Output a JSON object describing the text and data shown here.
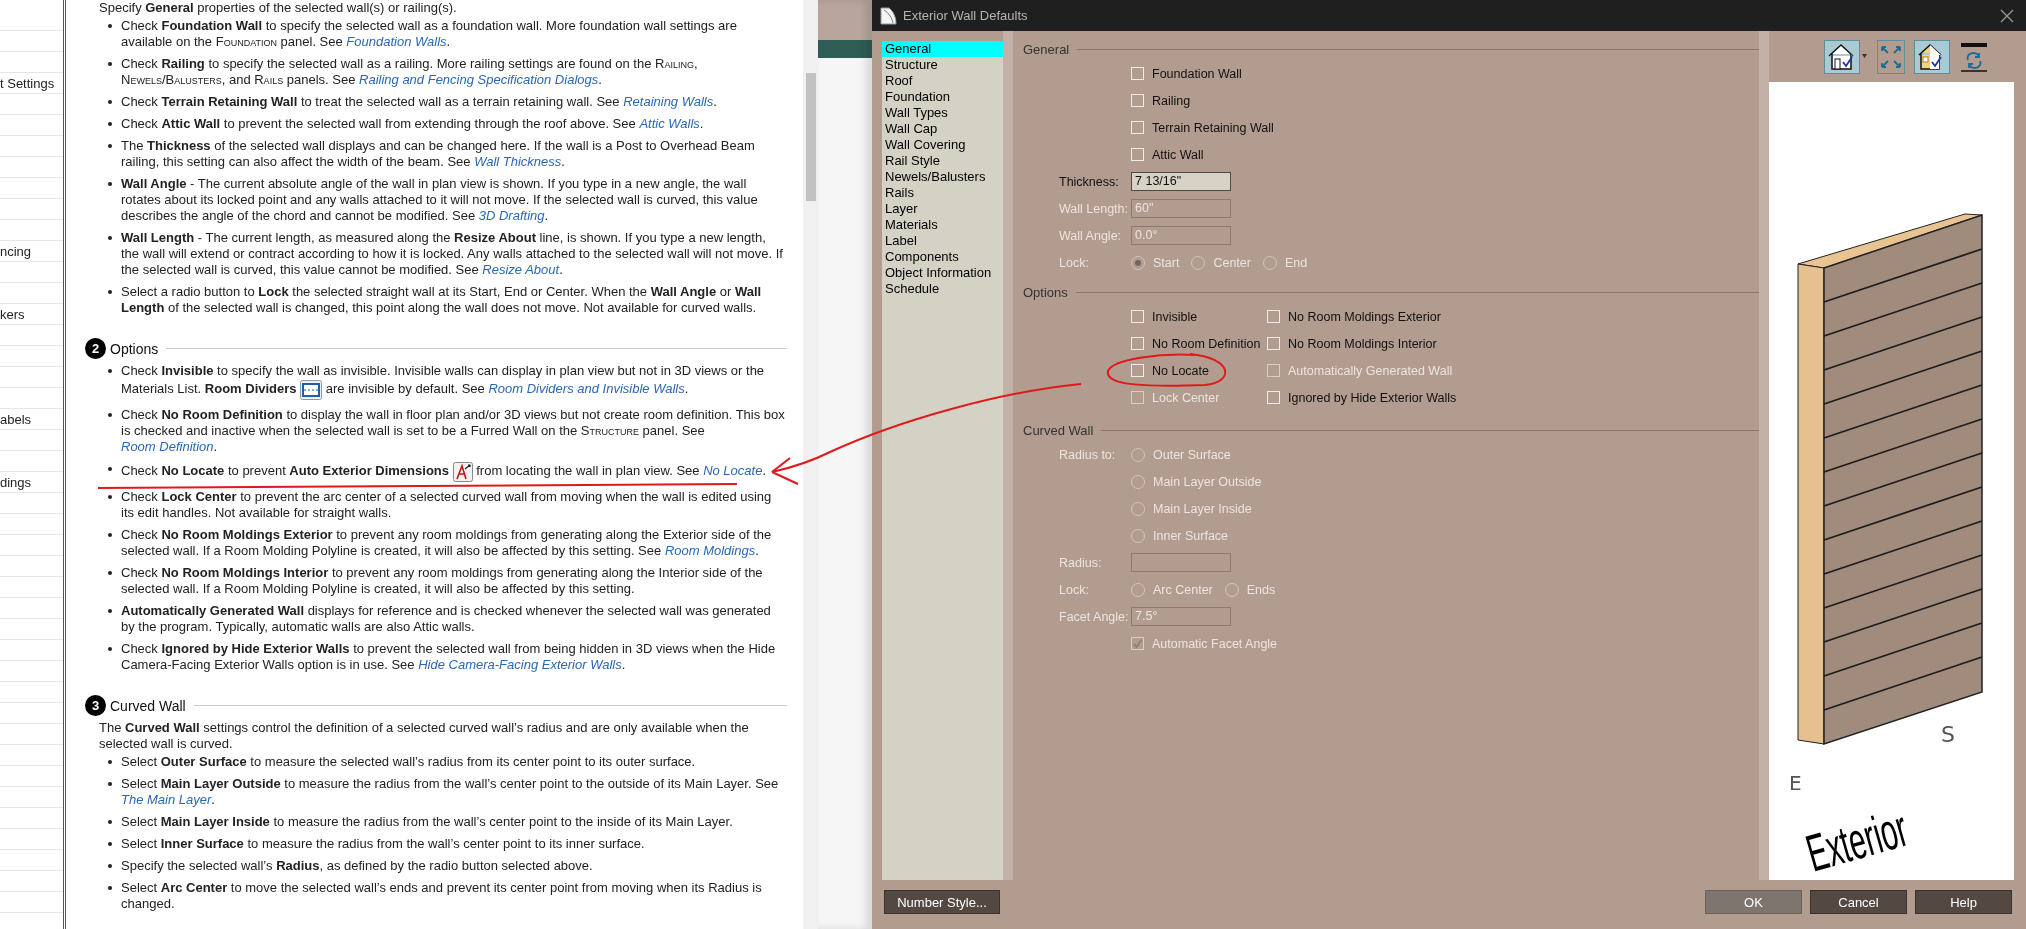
{
  "sidebar": {
    "items": [
      {
        "label": "t Settings"
      },
      {
        "label": "ncing"
      },
      {
        "label": "kers"
      },
      {
        "label": "abels"
      },
      {
        "label": "dings"
      }
    ]
  },
  "help": {
    "sections": [
      {
        "intro": "Specify **General** properties of the selected wall(s) or railing(s).",
        "bullets": [
          {
            "parts": [
              {
                "kind": "text",
                "text": "Check **Foundation Wall** to specify the selected wall as a foundation wall. More foundation wall settings are available on the "
              },
              {
                "kind": "smallcaps",
                "text": "Foundation"
              },
              {
                "kind": "text",
                "text": " panel. See "
              },
              {
                "kind": "link",
                "text": "Foundation Walls"
              },
              {
                "kind": "text",
                "text": "."
              }
            ]
          },
          {
            "parts": [
              {
                "kind": "text",
                "text": "Check **Railing** to specify the selected wall as a railing. More railing settings are found on the "
              },
              {
                "kind": "smallcaps",
                "text": "Railing"
              },
              {
                "kind": "text",
                "text": ", "
              },
              {
                "kind": "smallcaps",
                "text": "Newels/Balusters"
              },
              {
                "kind": "text",
                "text": ", and "
              },
              {
                "kind": "smallcaps",
                "text": "Rails"
              },
              {
                "kind": "text",
                "text": " panels. See "
              },
              {
                "kind": "link",
                "text": "Railing and Fencing Specification Dialogs"
              },
              {
                "kind": "text",
                "text": "."
              }
            ]
          },
          {
            "parts": [
              {
                "kind": "text",
                "text": "Check **Terrain Retaining Wall** to treat the selected wall as a terrain retaining wall. See "
              },
              {
                "kind": "link",
                "text": "Retaining Walls"
              },
              {
                "kind": "text",
                "text": "."
              }
            ]
          },
          {
            "parts": [
              {
                "kind": "text",
                "text": "Check **Attic Wall** to prevent the selected wall from extending through the roof above. See "
              },
              {
                "kind": "link",
                "text": "Attic Walls"
              },
              {
                "kind": "text",
                "text": "."
              }
            ]
          },
          {
            "parts": [
              {
                "kind": "text",
                "text": "The **Thickness** of the selected wall displays and can be changed here. If the wall is a Post to Overhead Beam railing, this setting can also affect the width of the beam. See "
              },
              {
                "kind": "link",
                "text": "Wall Thickness"
              },
              {
                "kind": "text",
                "text": "."
              }
            ]
          },
          {
            "parts": [
              {
                "kind": "text",
                "text": "**Wall Angle** - The current absolute angle of the wall in plan view is shown. If you type in a new angle, the wall rotates about its locked point and any walls attached to it will not move. If the selected wall is curved, this value describes the angle of the chord and cannot be modified. See "
              },
              {
                "kind": "link",
                "text": "3D Drafting"
              },
              {
                "kind": "text",
                "text": "."
              }
            ]
          },
          {
            "parts": [
              {
                "kind": "text",
                "text": "**Wall Length** - The current length, as measured along the **Resize About** line, is shown. If you type a new length, the wall will extend or contract according to how it is locked. Any walls attached to the selected wall will not move. If the selected wall is curved, this value cannot be modified. See "
              },
              {
                "kind": "link",
                "text": "Resize About"
              },
              {
                "kind": "text",
                "text": "."
              }
            ]
          },
          {
            "parts": [
              {
                "kind": "text",
                "text": "Select a radio button to **Lock** the selected straight wall at its Start, End or Center. When the **Wall Angle** or **Wall Length** of the selected wall is changed, this point along the wall does not move. Not available for curved walls."
              }
            ]
          }
        ]
      },
      {
        "number": "2",
        "heading": "Options",
        "bullets": [
          {
            "parts": [
              {
                "kind": "text",
                "text": "Check **Invisible** to specify the wall as invisible. Invisible walls can display in plan view but not in 3D views or the Materials List. **Room Dividers** "
              },
              {
                "kind": "divider-icon"
              },
              {
                "kind": "text",
                "text": " are invisible by default. See "
              },
              {
                "kind": "link",
                "text": "Room Dividers and Invisible Walls"
              },
              {
                "kind": "text",
                "text": "."
              }
            ]
          },
          {
            "parts": [
              {
                "kind": "text",
                "text": "Check **No Room Definition** to display the wall in floor plan and/or 3D views but not create room definition. This box is checked and inactive when the selected wall is set to be a Furred Wall on the "
              },
              {
                "kind": "smallcaps",
                "text": "Structure"
              },
              {
                "kind": "text",
                "text": " panel. See "
              },
              {
                "kind": "link",
                "text": "Room Definition"
              },
              {
                "kind": "text",
                "text": "."
              }
            ]
          },
          {
            "parts": [
              {
                "kind": "text",
                "text": "Check **No Locate** to prevent **Auto Exterior Dimensions** "
              },
              {
                "kind": "dimension-icon"
              },
              {
                "kind": "text",
                "text": " from locating the wall in plan view. See "
              },
              {
                "kind": "link",
                "text": "No Locate"
              },
              {
                "kind": "text",
                "text": "."
              }
            ]
          },
          {
            "parts": [
              {
                "kind": "text",
                "text": "Check **Lock Center** to prevent the arc center of a selected curved wall from moving when the wall is edited using its edit handles. Not available for straight walls."
              }
            ]
          },
          {
            "parts": [
              {
                "kind": "text",
                "text": "Check **No Room Moldings Exterior** to prevent any room moldings from generating along the Exterior side of the selected wall. If a Room Molding Polyline is created, it will also be affected by this setting. See "
              },
              {
                "kind": "link",
                "text": "Room Moldings"
              },
              {
                "kind": "text",
                "text": "."
              }
            ]
          },
          {
            "parts": [
              {
                "kind": "text",
                "text": "Check **No Room Moldings Interior** to prevent any room moldings from generating along the Interior side of the selected wall. If a Room Molding Polyline is created, it will also be affected by this setting."
              }
            ]
          },
          {
            "parts": [
              {
                "kind": "text",
                "text": "**Automatically Generated Wall** displays for reference and is checked whenever the selected wall was generated by the program. Typically, automatic walls are also Attic walls."
              }
            ]
          },
          {
            "parts": [
              {
                "kind": "text",
                "text": "Check **Ignored by Hide Exterior Walls** to prevent the selected wall from being hidden in 3D views when the Hide Camera-Facing Exterior Walls option is in use. See "
              },
              {
                "kind": "link",
                "text": "Hide Camera-Facing Exterior Walls"
              },
              {
                "kind": "text",
                "text": "."
              }
            ]
          }
        ]
      },
      {
        "number": "3",
        "heading": "Curved Wall",
        "intro": "The **Curved Wall** settings control the definition of a selected curved wall’s radius and are only available when the selected wall is curved.",
        "bullets": [
          {
            "parts": [
              {
                "kind": "text",
                "text": "Select **Outer Surface** to measure the selected wall’s radius from its center point to its outer surface."
              }
            ]
          },
          {
            "parts": [
              {
                "kind": "text",
                "text": "Select **Main Layer Outside** to measure the radius from the wall’s center point to the outside of its Main Layer. See "
              },
              {
                "kind": "link",
                "text": "The Main Layer"
              },
              {
                "kind": "text",
                "text": "."
              }
            ]
          },
          {
            "parts": [
              {
                "kind": "text",
                "text": "Select **Main Layer Inside** to measure the radius from the wall’s center point to the inside of its Main Layer."
              }
            ]
          },
          {
            "parts": [
              {
                "kind": "text",
                "text": "Select **Inner Surface** to measure the radius from the wall’s center point to its inner surface."
              }
            ]
          },
          {
            "parts": [
              {
                "kind": "text",
                "text": "Specify the selected wall’s **Radius**, as defined by the radio button selected above."
              }
            ]
          },
          {
            "parts": [
              {
                "kind": "text",
                "text": "Select **Arc Center** to move the selected wall’s ends and prevent its center point from moving when its Radius is changed."
              }
            ]
          }
        ]
      }
    ]
  },
  "dialog": {
    "title": "Exterior Wall Defaults",
    "nav": [
      {
        "label": "General",
        "selected": true
      },
      {
        "label": "Structure",
        "selected": false
      },
      {
        "label": "Roof",
        "selected": false
      },
      {
        "label": "Foundation",
        "selected": false
      },
      {
        "label": "Wall Types",
        "selected": false
      },
      {
        "label": "Wall Cap",
        "selected": false
      },
      {
        "label": "Wall Covering",
        "selected": false
      },
      {
        "label": "Rail Style",
        "selected": false
      },
      {
        "label": "Newels/Balusters",
        "selected": false
      },
      {
        "label": "Rails",
        "selected": false
      },
      {
        "label": "Layer",
        "selected": false
      },
      {
        "label": "Materials",
        "selected": false
      },
      {
        "label": "Label",
        "selected": false
      },
      {
        "label": "Components",
        "selected": false
      },
      {
        "label": "Object Information",
        "selected": false
      },
      {
        "label": "Schedule",
        "selected": false
      }
    ],
    "general": {
      "heading": "General",
      "checkboxes": [
        {
          "label": "Foundation Wall",
          "checked": false,
          "disabled": false
        },
        {
          "label": "Railing",
          "checked": false,
          "disabled": false
        },
        {
          "label": "Terrain Retaining Wall",
          "checked": false,
          "disabled": false
        },
        {
          "label": "Attic Wall",
          "checked": false,
          "disabled": false
        }
      ],
      "fields": [
        {
          "label": "Thickness:",
          "value": "7 13/16\"",
          "disabled": false
        },
        {
          "label": "Wall Length:",
          "value": "60\"",
          "disabled": true
        },
        {
          "label": "Wall Angle:",
          "value": "0.0°",
          "disabled": true
        }
      ],
      "lock": {
        "label": "Lock:",
        "disabled": true,
        "options": [
          {
            "label": "Start",
            "selected": true
          },
          {
            "label": "Center",
            "selected": false
          },
          {
            "label": "End",
            "selected": false
          }
        ]
      }
    },
    "options": {
      "heading": "Options",
      "left": [
        {
          "label": "Invisible",
          "checked": false,
          "disabled": false
        },
        {
          "label": "No Room Definition",
          "checked": false,
          "disabled": false
        },
        {
          "label": "No Locate",
          "checked": false,
          "disabled": false
        },
        {
          "label": "Lock Center",
          "checked": false,
          "disabled": true
        }
      ],
      "right": [
        {
          "label": "No Room Moldings Exterior",
          "checked": false,
          "disabled": false
        },
        {
          "label": "No Room Moldings Interior",
          "checked": false,
          "disabled": false
        },
        {
          "label": "Automatically Generated Wall",
          "checked": false,
          "disabled": true
        },
        {
          "label": "Ignored by Hide Exterior Walls",
          "checked": false,
          "disabled": false
        }
      ]
    },
    "curved_wall": {
      "heading": "Curved Wall",
      "radius_to": {
        "label": "Radius to:",
        "disabled": true,
        "options": [
          {
            "label": "Outer Surface",
            "selected": false
          },
          {
            "label": "Main Layer Outside",
            "selected": false
          },
          {
            "label": "Main Layer Inside",
            "selected": false
          },
          {
            "label": "Inner Surface",
            "selected": false
          }
        ]
      },
      "radius": {
        "label": "Radius:",
        "disabled": true
      },
      "lock": {
        "label": "Lock:",
        "disabled": true,
        "options": [
          {
            "label": "Arc Center",
            "selected": false
          },
          {
            "label": "Ends",
            "selected": false
          }
        ]
      },
      "facet_angle": {
        "label": "Facet Angle:",
        "value": "7.5°",
        "disabled": true
      },
      "automatic_facet_angle": {
        "label": "Automatic Facet Angle",
        "checked": true,
        "disabled": true
      }
    },
    "preview": {
      "compass_labels": [
        "S",
        "E"
      ],
      "side_label": "Exterior"
    },
    "number_style_button": "Number Style...",
    "buttons": [
      {
        "label": "OK",
        "default": true
      },
      {
        "label": "Cancel",
        "default": false
      },
      {
        "label": "Help",
        "default": false
      }
    ]
  }
}
